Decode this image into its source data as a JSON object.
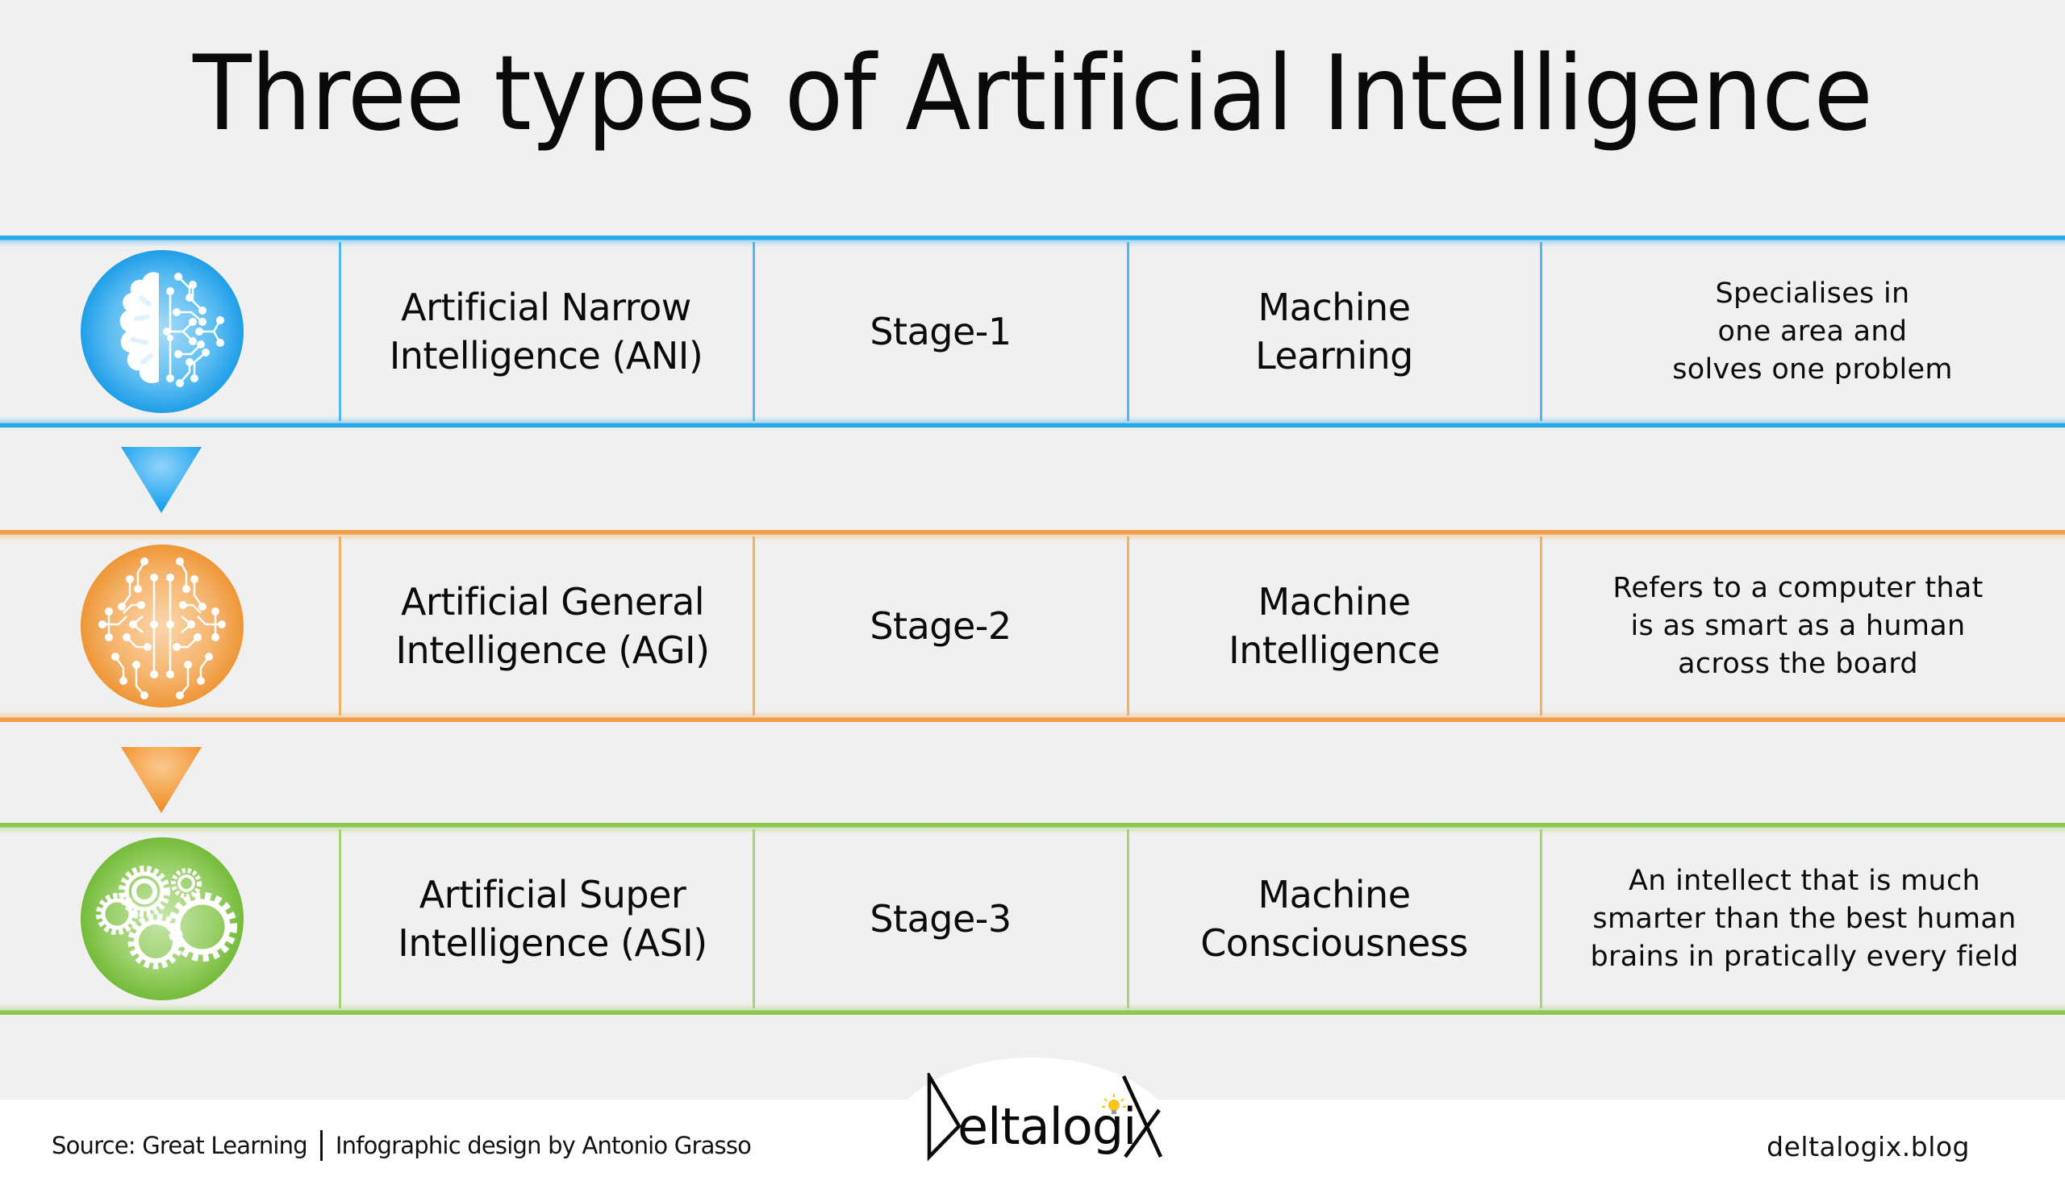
{
  "title": "Three types of Artificial Intelligence",
  "colors": {
    "background": "#f0f0f0",
    "footer": "#ffffff",
    "blue": "#29a8ea",
    "orange": "#f0a048",
    "green": "#8cc850",
    "text": "#0a0a0a",
    "lightbulb": "#f7c51b"
  },
  "rows": [
    {
      "icon": "brain-circuit-icon",
      "color": "blue",
      "name": "Artificial Narrow\nIntelligence (ANI)",
      "stage": "Stage-1",
      "category": "Machine\nLearning",
      "description": "Specialises in\none area and\nsolves one problem"
    },
    {
      "icon": "circuit-brain-icon",
      "color": "orange",
      "name": "Artificial General\nIntelligence (AGI)",
      "stage": "Stage-2",
      "category": "Machine\nIntelligence",
      "description": "Refers to a computer that\nis as smart as a human\nacross the board"
    },
    {
      "icon": "gears-icon",
      "color": "green",
      "name": "Artificial Super\nIntelligence (ASI)",
      "stage": "Stage-3",
      "category": "Machine\nConsciousness",
      "description": "An intellect that is much\nsmarter than the best human\nbrains in pratically every field"
    }
  ],
  "arrows": [
    {
      "icon": "down-triangle-icon",
      "color": "blue"
    },
    {
      "icon": "down-triangle-icon",
      "color": "orange"
    }
  ],
  "footer": {
    "source": "Source: Great Learning",
    "credit": "Infographic design by Antonio Grasso",
    "logo_text": "Deltalogix",
    "website": "deltalogix.blog"
  }
}
